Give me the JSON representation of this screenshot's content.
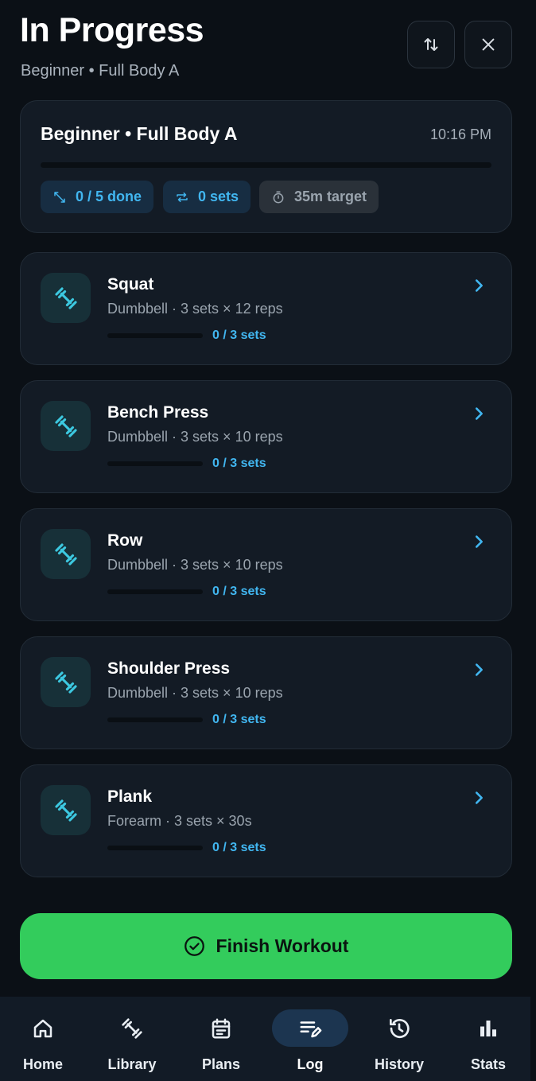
{
  "header": {
    "title": "In Progress",
    "subtitle": "Beginner • Full Body A",
    "sort_icon": "swap-vertical-icon",
    "close_icon": "close-icon"
  },
  "summary": {
    "title": "Beginner • Full Body A",
    "time": "10:16 PM",
    "progress_fraction": 0,
    "chips": {
      "done": "0 / 5 done",
      "sets": "0 sets",
      "target": "35m target"
    }
  },
  "exercises": [
    {
      "name": "Squat",
      "detail": "Dumbbell · 3 sets × 12 reps",
      "progress": "0 / 3 sets",
      "fraction": 0
    },
    {
      "name": "Bench Press",
      "detail": "Dumbbell · 3 sets × 10 reps",
      "progress": "0 / 3 sets",
      "fraction": 0
    },
    {
      "name": "Row",
      "detail": "Dumbbell · 3 sets × 10 reps",
      "progress": "0 / 3 sets",
      "fraction": 0
    },
    {
      "name": "Shoulder Press",
      "detail": "Dumbbell · 3 sets × 10 reps",
      "progress": "0 / 3 sets",
      "fraction": 0
    },
    {
      "name": "Plank",
      "detail": "Forearm · 3 sets × 30s",
      "progress": "0 / 3 sets",
      "fraction": 0
    }
  ],
  "finish_button": {
    "label": "Finish Workout",
    "icon": "check-circle-icon"
  },
  "nav": [
    {
      "label": "Home",
      "icon": "home-icon",
      "active": false
    },
    {
      "label": "Library",
      "icon": "dumbbell-icon",
      "active": false
    },
    {
      "label": "Plans",
      "icon": "calendar-icon",
      "active": false
    },
    {
      "label": "Log",
      "icon": "edit-note-icon",
      "active": true
    },
    {
      "label": "History",
      "icon": "history-icon",
      "active": false
    },
    {
      "label": "Stats",
      "icon": "bar-chart-icon",
      "active": false
    }
  ],
  "colors": {
    "accent": "#38bdf8",
    "finish": "#33cc5c",
    "background": "#0b1016",
    "card": "#131b25"
  }
}
